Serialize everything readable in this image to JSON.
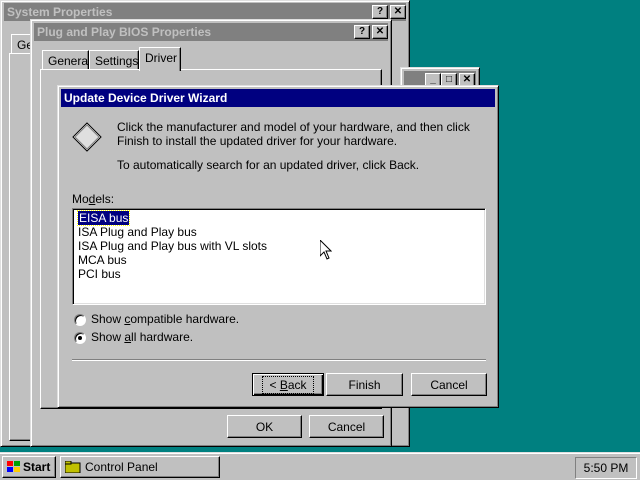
{
  "system_properties": {
    "title": "System Properties",
    "tab_partial": "Ge"
  },
  "pnp_bios": {
    "title": "Plug and Play BIOS Properties",
    "tabs": [
      "General",
      "Settings",
      "Driver"
    ],
    "ok_label": "OK",
    "cancel_label": "Cancel"
  },
  "wizard": {
    "title": "Update Device Driver Wizard",
    "instruction_1": "Click the manufacturer and model of your hardware, and then click Finish to install the updated driver for your hardware.",
    "instruction_2": "To automatically search for an updated driver, click Back.",
    "models_label_pre": "Mo",
    "models_label_key": "d",
    "models_label_post": "els:",
    "models": [
      "EISA bus",
      "ISA Plug and Play bus",
      "ISA Plug and Play bus with VL slots",
      "MCA bus",
      "PCI bus"
    ],
    "selected_index": 0,
    "radio_compatible_pre": "Show ",
    "radio_compatible_key": "c",
    "radio_compatible_post": "ompatible hardware.",
    "radio_all_pre": "Show ",
    "radio_all_key": "a",
    "radio_all_post": "ll hardware.",
    "selected_radio": "all",
    "back_prefix": "< ",
    "back_key": "B",
    "back_rest": "ack",
    "finish_label": "Finish",
    "cancel_label": "Cancel"
  },
  "title_buttons": {
    "help": "?",
    "close": "✕",
    "minimize": "_",
    "maximize": "□"
  },
  "taskbar": {
    "start_label": "Start",
    "task_control_panel": "Control Panel",
    "clock": "5:50 PM"
  },
  "colors": {
    "desktop": "#008080",
    "title_active": "#000080",
    "title_inactive": "#808080",
    "face": "#c0c0c0"
  }
}
